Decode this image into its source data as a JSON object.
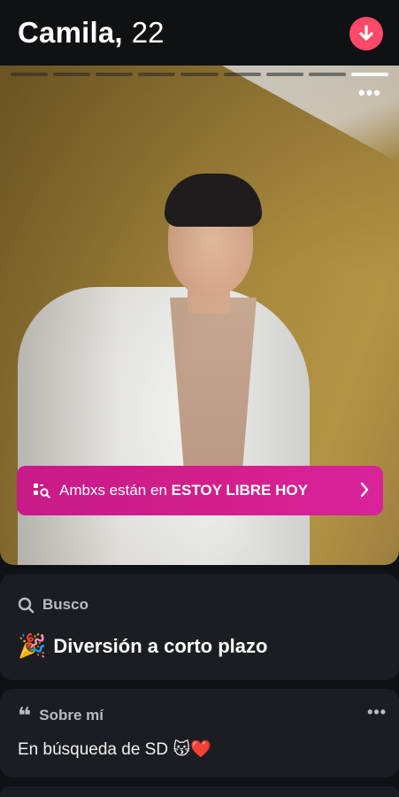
{
  "header": {
    "name": "Camila,",
    "age": "22",
    "down_icon": "arrow-down-icon",
    "down_color": "#fd4a68"
  },
  "photo": {
    "total_photos": 9,
    "active_photo_index": 9,
    "more_label": "•••",
    "banner": {
      "icon": "search-list-icon",
      "prefix": "Ambxs están en",
      "highlight": "ESTOY LIBRE HOY",
      "color": "#d21f8b"
    }
  },
  "busco": {
    "label": "Busco",
    "icon": "search-icon",
    "emoji": "🎉",
    "value": "Diversión a corto plazo"
  },
  "sobre": {
    "quote": "❝",
    "label": "Sobre mí",
    "more": "•••",
    "bio": "En búsqueda de SD 😽❤️"
  }
}
